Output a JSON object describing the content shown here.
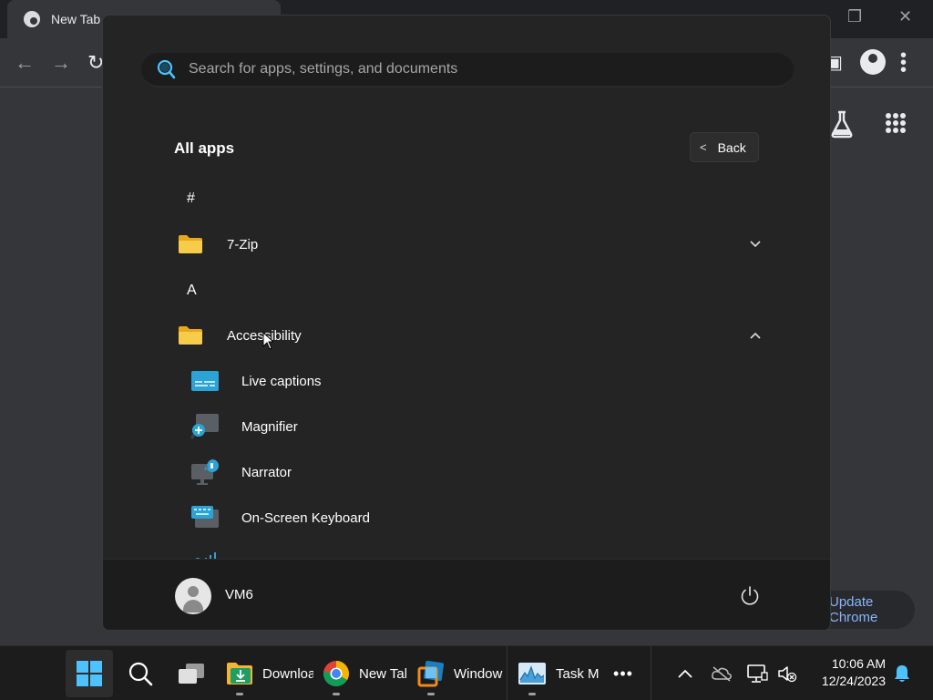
{
  "chrome": {
    "tab_title": "New Tab",
    "update_label": "Update Chrome"
  },
  "start_menu": {
    "search_placeholder": "Search for apps, settings, and documents",
    "title": "All apps",
    "back_label": "Back",
    "groups": [
      {
        "letter": "#",
        "items": [
          {
            "name": "7-Zip",
            "type": "folder",
            "expanded": false
          }
        ]
      },
      {
        "letter": "A",
        "items": [
          {
            "name": "Accessibility",
            "type": "folder",
            "expanded": true,
            "children": [
              {
                "name": "Live captions",
                "icon": "live-captions-icon"
              },
              {
                "name": "Magnifier",
                "icon": "magnifier-icon"
              },
              {
                "name": "Narrator",
                "icon": "narrator-icon"
              },
              {
                "name": "On-Screen Keyboard",
                "icon": "on-screen-keyboard-icon"
              }
            ]
          }
        ]
      }
    ],
    "user": {
      "name": "VM6"
    }
  },
  "taskbar": {
    "apps": [
      {
        "label": "Downloads",
        "icon": "file-explorer-downloads-icon"
      },
      {
        "label": "New Tab",
        "icon": "chrome-icon"
      },
      {
        "label": "Windows",
        "icon": "virtualbox-icon"
      },
      {
        "label": "Task Manager",
        "icon": "task-manager-icon"
      }
    ],
    "clock": {
      "time": "10:06 AM",
      "date": "12/24/2023"
    }
  },
  "colors": {
    "accent": "#4cc2ff",
    "folder": "#f5c542",
    "menu_bg": "#242424",
    "taskbar_bg": "#1c1c1c"
  }
}
